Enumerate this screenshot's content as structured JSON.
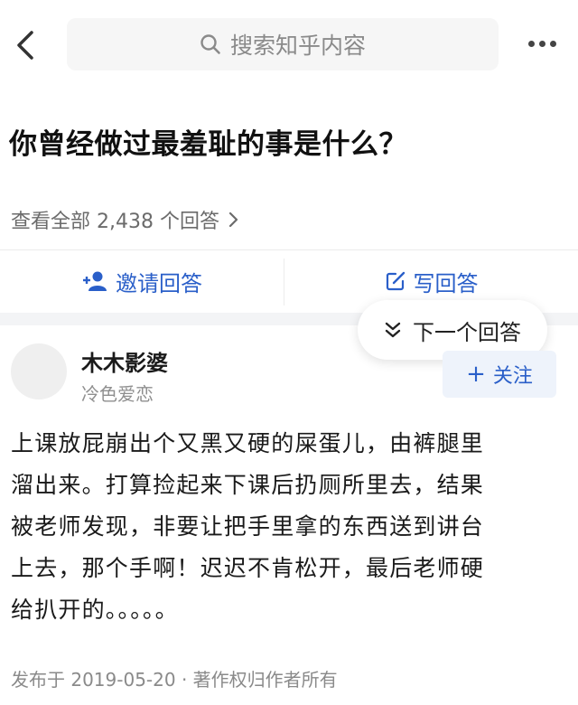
{
  "header": {
    "search_placeholder": "搜索知乎内容",
    "back_icon": "chevron-left-icon",
    "more_icon": "more-horizontal-icon"
  },
  "question": {
    "title": "你曾经做过最羞耻的事是什么？",
    "view_all": "查看全部 2,438 个回答"
  },
  "actions": {
    "invite_label": "邀请回答",
    "write_label": "写回答"
  },
  "floating": {
    "next_answer_label": "下一个回答"
  },
  "answer": {
    "author_name": "木木影婆",
    "author_bio": "冷色爱恋",
    "follow_label": "关注",
    "body_lines": [
      "上课放屁崩出个又黑又硬的屎蛋儿，由裤腿里",
      "溜出来。打算捡起来下课后扔厕所里去，结果",
      "被老师发现，非要让把手里拿的东西送到讲台",
      "上去，那个手啊！迟迟不肯松开，最后老师硬",
      "给扒开的。。。。。"
    ],
    "meta": "发布于 2019-05-20 · 著作权归作者所有"
  },
  "colors": {
    "accent": "#2a5fc9",
    "search_bg": "#f6f6f6",
    "secondary_text": "#8a8a8a",
    "section_gap": "#f3f4f6"
  }
}
